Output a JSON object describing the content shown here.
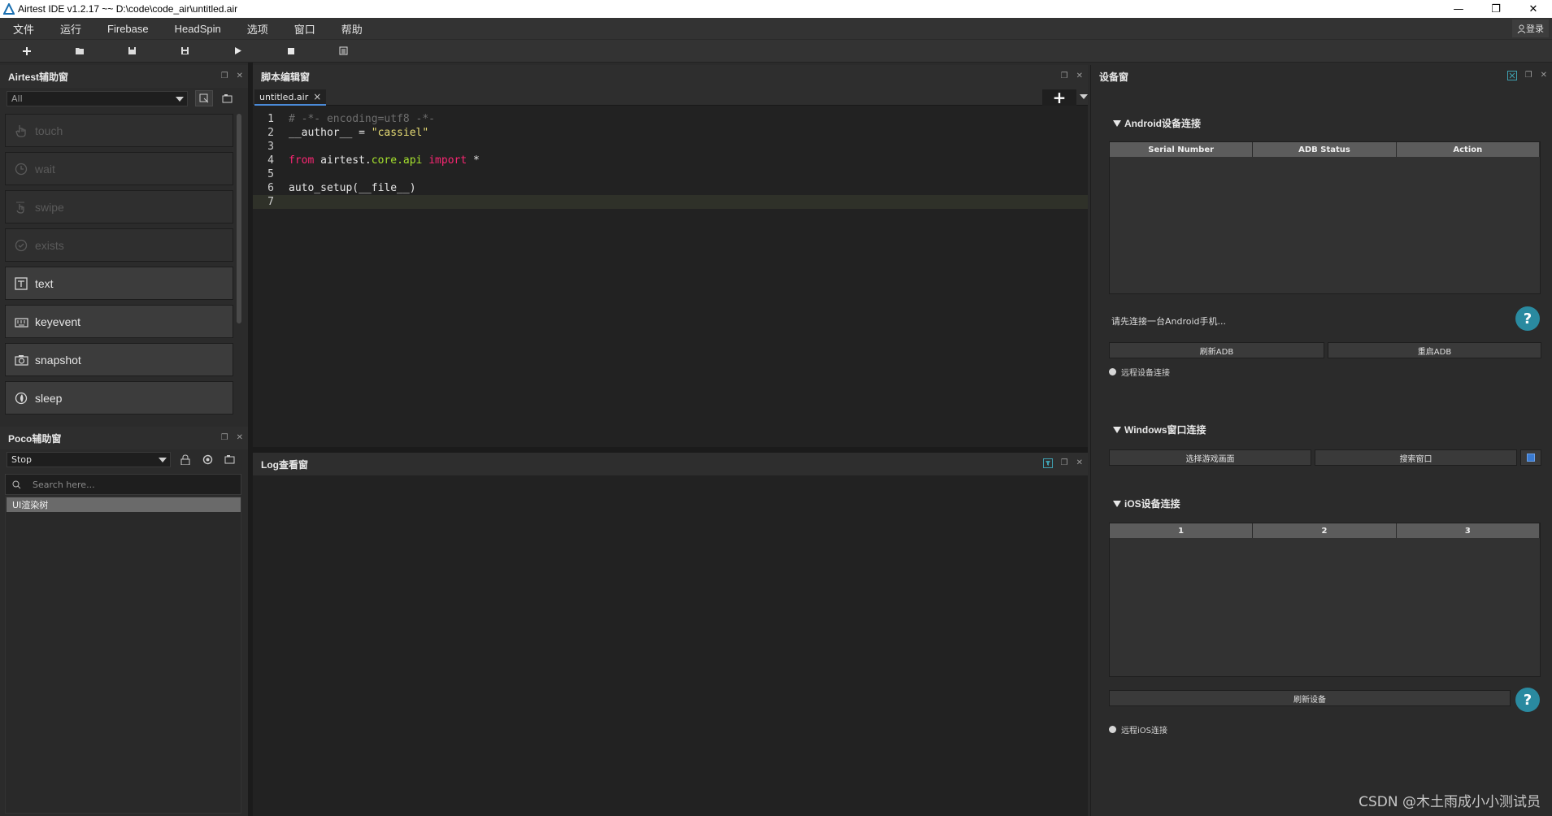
{
  "window": {
    "title": "Airtest IDE v1.2.17 ~~ D:\\code\\code_air\\untitled.air",
    "controls": [
      "—",
      "❐",
      "✕"
    ]
  },
  "menubar": {
    "items": [
      "文件",
      "运行",
      "Firebase",
      "HeadSpin",
      "选项",
      "窗口",
      "帮助"
    ],
    "login_label": "登录"
  },
  "toolbar": {
    "icons": [
      "new-file-icon",
      "open-folder-icon",
      "save-icon",
      "save-as-icon",
      "run-icon",
      "stop-icon",
      "log-icon"
    ]
  },
  "airtest_panel": {
    "title": "Airtest辅助窗",
    "filter": "All",
    "apis": [
      {
        "label": "touch",
        "icon": "hand-icon",
        "enabled": false
      },
      {
        "label": "wait",
        "icon": "clock-icon",
        "enabled": false
      },
      {
        "label": "swipe",
        "icon": "swipe-icon",
        "enabled": false
      },
      {
        "label": "exists",
        "icon": "check-circle-icon",
        "enabled": false
      },
      {
        "label": "text",
        "icon": "text-box-icon",
        "enabled": true
      },
      {
        "label": "keyevent",
        "icon": "keyboard-icon",
        "enabled": true
      },
      {
        "label": "snapshot",
        "icon": "camera-icon",
        "enabled": true
      },
      {
        "label": "sleep",
        "icon": "moon-icon",
        "enabled": true
      }
    ]
  },
  "poco_panel": {
    "title": "Poco辅助窗",
    "mode": "Stop",
    "search_placeholder": "Search here...",
    "tree_root": "UI渲染树"
  },
  "editor": {
    "title": "脚本编辑窗",
    "tab": "untitled.air",
    "lines": [
      "1",
      "2",
      "3",
      "4",
      "5",
      "6",
      "7"
    ],
    "code": {
      "l1": "# -*- encoding=utf8 -*-",
      "l2_var": "__author__ = ",
      "l2_str": "\"cassiel\"",
      "l4_from": "from",
      "l4_mod": "airtest.core.api",
      "l4_import": "import",
      "l4_star": "*",
      "l6": "auto_setup(__file__)"
    }
  },
  "log": {
    "title": "Log查看窗"
  },
  "device": {
    "title": "设备窗",
    "android": {
      "title": "Android设备连接",
      "columns": [
        "Serial Number",
        "ADB Status",
        "Action"
      ],
      "note": "请先连接一台Android手机...",
      "refresh_adb": "刷新ADB",
      "restart_adb": "重启ADB",
      "remote": "远程设备连接"
    },
    "windows": {
      "title": "Windows窗口连接",
      "select_game": "选择游戏画面",
      "search_window": "搜索窗口"
    },
    "ios": {
      "title": "iOS设备连接",
      "columns": [
        "1",
        "2",
        "3"
      ],
      "refresh": "刷新设备",
      "remote": "远程iOS连接"
    },
    "help_label": "?"
  },
  "watermark": "CSDN @木土雨成小小测试员"
}
